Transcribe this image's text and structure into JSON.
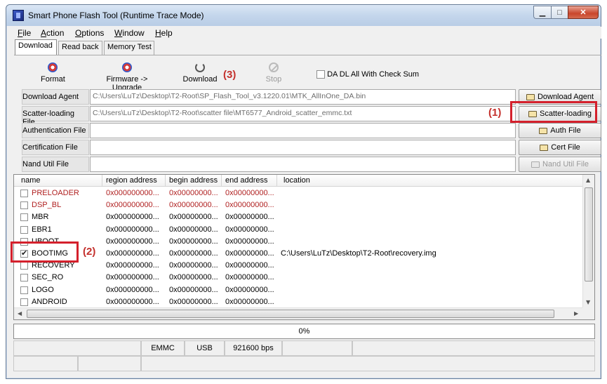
{
  "window": {
    "title": "Smart Phone Flash Tool (Runtime Trace Mode)"
  },
  "menu": [
    {
      "label": "File",
      "u": "F",
      "rest": "ile"
    },
    {
      "label": "Action",
      "u": "A",
      "rest": "ction"
    },
    {
      "label": "Options",
      "u": "O",
      "rest": "ptions"
    },
    {
      "label": "Window",
      "u": "W",
      "rest": "indow"
    },
    {
      "label": "Help",
      "u": "H",
      "rest": "elp"
    }
  ],
  "tabs": [
    "Download",
    "Read back",
    "Memory Test"
  ],
  "toolbar": {
    "format": "Format",
    "firmware_upgrade": "Firmware -> Upgrade",
    "download": "Download",
    "stop": "Stop",
    "da_dl_checksum": "DA DL All With Check Sum"
  },
  "files": {
    "download_agent": {
      "label": "Download Agent",
      "value": "C:\\Users\\LuTz\\Desktop\\T2-Root\\SP_Flash_Tool_v3.1220.01\\MTK_AllInOne_DA.bin",
      "button": "Download Agent"
    },
    "scatter": {
      "label": "Scatter-loading File",
      "value": "C:\\Users\\LuTz\\Desktop\\T2-Root\\scatter file\\MT6577_Android_scatter_emmc.txt",
      "button": "Scatter-loading"
    },
    "auth": {
      "label": "Authentication File",
      "value": "",
      "button": "Auth File"
    },
    "cert": {
      "label": "Certification File",
      "value": "",
      "button": "Cert File"
    },
    "nand": {
      "label": "Nand Util File",
      "value": "",
      "button": "Nand Util File"
    }
  },
  "table": {
    "columns": [
      "name",
      "region address",
      "begin address",
      "end address",
      "location"
    ],
    "rows": [
      {
        "name": "PRELOADER",
        "region": "0x000000000...",
        "begin": "0x00000000...",
        "end": "0x00000000...",
        "location": "",
        "checked": false,
        "red": true
      },
      {
        "name": "DSP_BL",
        "region": "0x000000000...",
        "begin": "0x00000000...",
        "end": "0x00000000...",
        "location": "",
        "checked": false,
        "red": true
      },
      {
        "name": "MBR",
        "region": "0x000000000...",
        "begin": "0x00000000...",
        "end": "0x00000000...",
        "location": "",
        "checked": false,
        "red": false
      },
      {
        "name": "EBR1",
        "region": "0x000000000...",
        "begin": "0x00000000...",
        "end": "0x00000000...",
        "location": "",
        "checked": false,
        "red": false
      },
      {
        "name": "UBOOT",
        "region": "0x000000000...",
        "begin": "0x00000000...",
        "end": "0x00000000...",
        "location": "",
        "checked": false,
        "red": false
      },
      {
        "name": "BOOTIMG",
        "region": "0x000000000...",
        "begin": "0x00000000...",
        "end": "0x00000000...",
        "location": "C:\\Users\\LuTz\\Desktop\\T2-Root\\recovery.img",
        "checked": true,
        "red": false
      },
      {
        "name": "RECOVERY",
        "region": "0x000000000...",
        "begin": "0x00000000...",
        "end": "0x00000000...",
        "location": "",
        "checked": false,
        "red": false
      },
      {
        "name": "SEC_RO",
        "region": "0x000000000...",
        "begin": "0x00000000...",
        "end": "0x00000000...",
        "location": "",
        "checked": false,
        "red": false
      },
      {
        "name": "LOGO",
        "region": "0x000000000...",
        "begin": "0x00000000...",
        "end": "0x00000000...",
        "location": "",
        "checked": false,
        "red": false
      },
      {
        "name": "ANDROID",
        "region": "0x000000000...",
        "begin": "0x00000000...",
        "end": "0x00000000...",
        "location": "",
        "checked": false,
        "red": false
      }
    ]
  },
  "progress": {
    "text": "0%",
    "fraction": 0
  },
  "status": {
    "storage": "EMMC",
    "conn": "USB",
    "baud": "921600 bps"
  },
  "annotations": {
    "a1": "(1)",
    "a2": "(2)",
    "a3": "(3)"
  },
  "colors": {
    "highlight": "#d4202c",
    "annotation": "#c4302c",
    "red_text": "#b02020"
  }
}
